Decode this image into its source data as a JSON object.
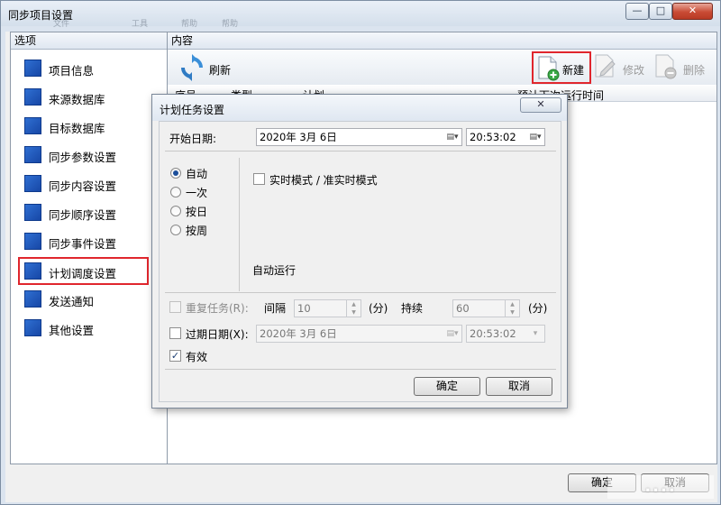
{
  "window": {
    "title": "同步项目设置",
    "ghost_menu": [
      "文件",
      "工具",
      "帮助",
      "帮助"
    ],
    "minimize_glyph": "—",
    "maximize_glyph": "□",
    "close_glyph": "✕",
    "ok_label": "确定",
    "cancel_label": "取消"
  },
  "left_panel": {
    "header": "选项",
    "items": [
      {
        "label": "项目信息"
      },
      {
        "label": "来源数据库"
      },
      {
        "label": "目标数据库"
      },
      {
        "label": "同步参数设置"
      },
      {
        "label": "同步内容设置"
      },
      {
        "label": "同步顺序设置"
      },
      {
        "label": "同步事件设置"
      },
      {
        "label": "计划调度设置",
        "selected": true
      },
      {
        "label": "发送通知"
      },
      {
        "label": "其他设置"
      }
    ]
  },
  "right_panel": {
    "header": "内容",
    "toolbar": {
      "refresh_label": "刷新",
      "new_label": "新建",
      "edit_label": "修改",
      "delete_label": "删除"
    },
    "columns": [
      "序号",
      "类型",
      "计划",
      "预计下次运行时间"
    ]
  },
  "dialog": {
    "title": "计划任务设置",
    "close_glyph": "✕",
    "start_date_label": "开始日期:",
    "start_date": "2020年  3月  6日",
    "start_time": "20:53:02",
    "modes": [
      {
        "label": "自动",
        "checked": true
      },
      {
        "label": "一次",
        "checked": false
      },
      {
        "label": "按日",
        "checked": false
      },
      {
        "label": "按周",
        "checked": false
      }
    ],
    "realtime_label": "实时模式 / 准实时模式",
    "realtime_checked": false,
    "auto_run_label": "自动运行",
    "repeat_label": "重复任务(R):",
    "repeat_checked": false,
    "interval_label": "间隔",
    "interval_value": "10",
    "interval_unit": "(分)",
    "duration_label": "持续",
    "duration_value": "60",
    "duration_unit": "(分)",
    "expiry_label": "过期日期(X):",
    "expiry_checked": false,
    "expiry_date": "2020年  3月  6日",
    "expiry_time": "20:53:02",
    "valid_label": "有效",
    "valid_checked": true,
    "ok_label": "确定",
    "cancel_label": "取消"
  },
  "watermark": "...."
}
